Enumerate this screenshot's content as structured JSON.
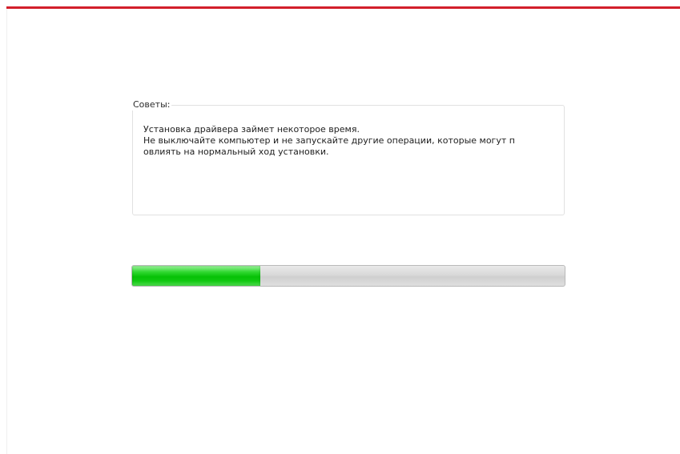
{
  "tips": {
    "legend": "Советы:",
    "lines": [
      "Установка драйвера займет некоторое время.",
      "Не выключайте компьютер и не запускайте другие операции, которые могут п",
      "овлиять на нормальный ход установки."
    ]
  },
  "progress": {
    "fraction": 0.297
  },
  "colors": {
    "accent": "#d21f2b",
    "progress_fill": "#06c106",
    "progress_track": "#d9d9d9"
  }
}
